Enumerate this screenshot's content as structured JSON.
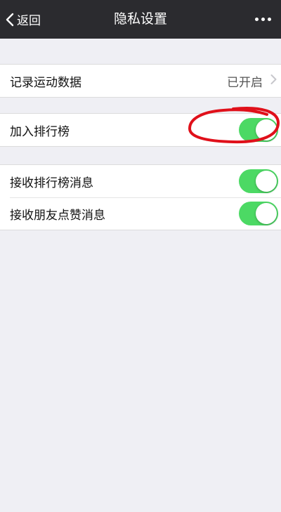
{
  "nav": {
    "back_label": "返回",
    "title": "隐私设置",
    "back_icon": "chevron-left-icon",
    "more_icon": "more-dots-icon"
  },
  "sections": [
    {
      "rows": [
        {
          "label": "记录运动数据",
          "value": "已开启",
          "type": "link"
        }
      ]
    },
    {
      "rows": [
        {
          "label": "加入排行榜",
          "type": "toggle",
          "on": true
        }
      ]
    },
    {
      "rows": [
        {
          "label": "接收排行榜消息",
          "type": "toggle",
          "on": true
        },
        {
          "label": "接收朋友点赞消息",
          "type": "toggle",
          "on": true
        }
      ]
    }
  ],
  "colors": {
    "nav_bg": "#2b2b2f",
    "page_bg": "#efeff4",
    "toggle_on": "#4cd964",
    "annotation": "#e0101a"
  }
}
